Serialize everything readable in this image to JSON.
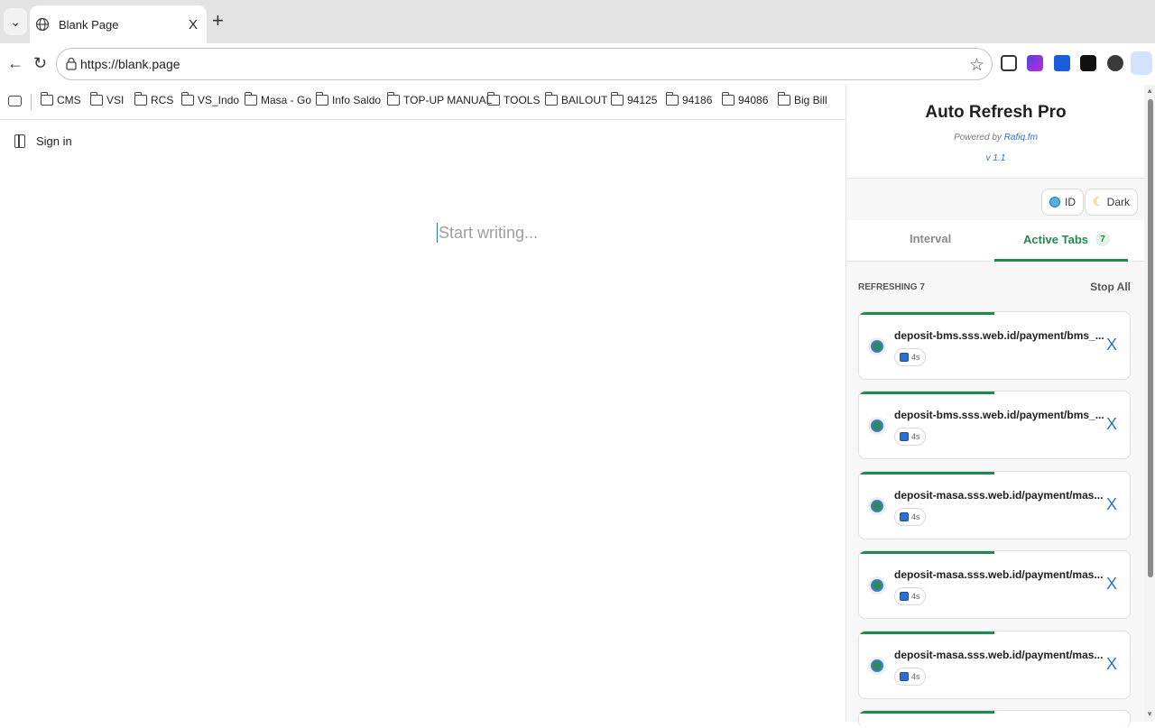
{
  "browser": {
    "tab_title": "Blank Page",
    "tab_close": "X",
    "new_tab": "+",
    "url": "https://blank.page"
  },
  "bookmarks": [
    "CMS",
    "VSI",
    "RCS",
    "VS_Indo",
    "Masa - Go",
    "Info Saldo",
    "TOP-UP MANUAL",
    "TOOLS",
    "BAILOUT",
    "94125",
    "94186",
    "94086",
    "Big Bill"
  ],
  "page": {
    "signin_label": "Sign in",
    "editor_placeholder": "Start writing..."
  },
  "panel": {
    "title": "Auto Refresh Pro",
    "powered_prefix": "Powered by ",
    "powered_link": "Rafiq.fm",
    "version": "v 1.1",
    "lang_button": "ID",
    "theme_button": "Dark",
    "tab_interval": "Interval",
    "tab_active": "Active Tabs",
    "tab_active_count": "7",
    "list_heading": "REFRESHING 7",
    "stop_all": "Stop All",
    "close_glyph": "X",
    "cards": [
      {
        "url": "deposit-bms.sss.web.id/payment/bms_...",
        "interval": "4s",
        "progress": 0.5
      },
      {
        "url": "deposit-bms.sss.web.id/payment/bms_...",
        "interval": "4s",
        "progress": 0.5
      },
      {
        "url": "deposit-masa.sss.web.id/payment/mas...",
        "interval": "4s",
        "progress": 0.5
      },
      {
        "url": "deposit-masa.sss.web.id/payment/mas...",
        "interval": "4s",
        "progress": 0.5
      },
      {
        "url": "deposit-masa.sss.web.id/payment/mas...",
        "interval": "4s",
        "progress": 0.5
      }
    ]
  },
  "colors": {
    "accent_green": "#1f8a4c",
    "link_blue": "#2b6fd6"
  }
}
